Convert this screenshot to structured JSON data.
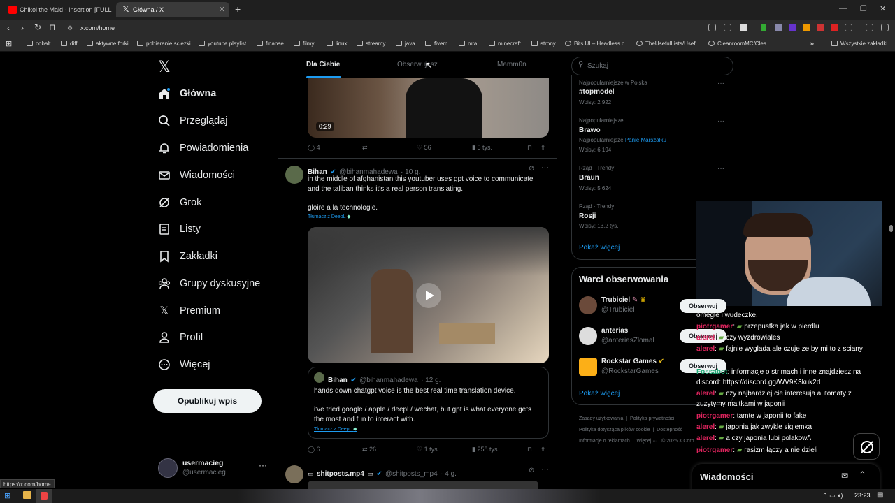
{
  "browser": {
    "tabs": [
      {
        "label": "Chikoi the Maid - Insertion [FULL"
      },
      {
        "label": "Główna / X"
      }
    ],
    "url": "x.com/home",
    "bookmarks": [
      "cobalt",
      "diff",
      "aktywne forki",
      "pobieranie sciezki",
      "youtube playlist",
      "finanse",
      "filmy",
      "linux",
      "streamy",
      "java",
      "fivem",
      "mta",
      "minecraft",
      "strony",
      "Bits UI – Headless c...",
      "TheUsefulLists/Usef...",
      "CleanroomMC/Clea..."
    ],
    "bookmarks_all": "Wszystkie zakładki",
    "status_url": "https://x.com/home"
  },
  "nav": {
    "items": [
      "Główna",
      "Przeglądaj",
      "Powiadomienia",
      "Wiadomości",
      "Grok",
      "Listy",
      "Zakładki",
      "Grupy dyskusyjne",
      "Premium",
      "Profil",
      "Więcej"
    ],
    "post_button": "Opublikuj wpis",
    "user_name": "usermacieg",
    "user_handle": "@usermacieg"
  },
  "tabs": {
    "for_you": "Dla Ciebie",
    "following": "Obserwujesz",
    "list": "Mamm0n"
  },
  "post0": {
    "duration": "0:29",
    "replies": "4",
    "likes": "56",
    "views": "5 tys."
  },
  "post1": {
    "name": "Bihan",
    "handle": "@bihanmahadewa",
    "time": "· 10 g.",
    "text1": "in the middle of afghanistan this youtuber uses gpt voice to communicate",
    "text2": "and the taliban thinks it's a real person translating.",
    "text3": "gloire a la technologie.",
    "translate": "Tłumacz z DeepL",
    "quote": {
      "name": "Bihan",
      "handle": "@bihanmahadewa",
      "time": "· 12 g.",
      "text1": "hands down chatgpt voice is the best real time translation device.",
      "text2": "i've tried google / apple / deepl / wechat, but gpt is what everyone gets",
      "text3": "the most and fun to interact with.",
      "translate": "Tłumacz z DeepL"
    },
    "replies": "6",
    "reposts": "26",
    "likes": "1 tys.",
    "views": "258 tys."
  },
  "post2": {
    "name": "shitposts.mp4",
    "handle": "@shitposts_mp4",
    "time": "· 4 g."
  },
  "search": {
    "placeholder": "Szukaj"
  },
  "trends": [
    {
      "meta": "Najpopularniejsze w Polska",
      "tag": "#topmodel",
      "count": "Wpisy: 2 922"
    },
    {
      "meta": "Najpopularniejsze",
      "tag": "Brawo",
      "extra_label": "Najpopularniejsze",
      "extra_link": "Panie Marszałku",
      "count": "Wpisy: 6 194"
    },
    {
      "meta": "Rząd · Trendy",
      "tag": "Braun",
      "count": "Wpisy: 5 624"
    },
    {
      "meta": "Rząd · Trendy",
      "tag": "Rosji",
      "count": "Wpisy: 13,2 tys."
    }
  ],
  "show_more": "Pokaż więcej",
  "who_to_follow": {
    "title": "Warci obserwowania",
    "follow": "Obserwuj",
    "users": [
      {
        "name": "Trubiciel",
        "handle": "@Trubiciel"
      },
      {
        "name": "anterias",
        "handle": "@anteriasZlomal"
      },
      {
        "name": "Rockstar Games",
        "handle": "@RockstarGames"
      }
    ],
    "show_more": "Pokaż więcej"
  },
  "footer": [
    "Zasady użytkowania",
    "Polityka prywatności",
    "Polityka dotycząca plików cookie",
    "Dostępność",
    "Informacje o reklamach",
    "Więcej ···",
    "© 2025 X Corp."
  ],
  "messages_title": "Wiadomości",
  "chat": [
    {
      "user": "",
      "msg": "omegle i wudeczke."
    },
    {
      "user": "piotrgamer",
      "msg": "przepustka jak w pierdlu"
    },
    {
      "user": "alerel",
      "msg": "czy wyzdrowiales"
    },
    {
      "user": "alerel",
      "msg": "fajnie wyglada ale czuje ze by mi to z sciany"
    },
    {
      "user": "Fossabot",
      "msg": "informacje o strimach i inne znajdziesz na"
    },
    {
      "user": "",
      "msg": "discord: https://discord.gg/WV9K3kuk2d"
    },
    {
      "user": "alerel",
      "msg": "czy najbardziej cie interesuja automaty z"
    },
    {
      "user": "",
      "msg": "zuzytymy majtkami w japonii"
    },
    {
      "user": "piotrgamer",
      "msg": "tamte w japonii to fake"
    },
    {
      "user": "alerel",
      "msg": "japonia jak zwykle sigiemka"
    },
    {
      "user": "alerel",
      "msg": "a czy japonia lubi polakow/\\"
    },
    {
      "user": "piotrgamer",
      "msg": "rasizm łączy a nie dzieli"
    }
  ],
  "clock": "23:23",
  "colors": {
    "bg": "#000000",
    "accent": "#1d9bf0",
    "chat_user": "#e0245e"
  }
}
